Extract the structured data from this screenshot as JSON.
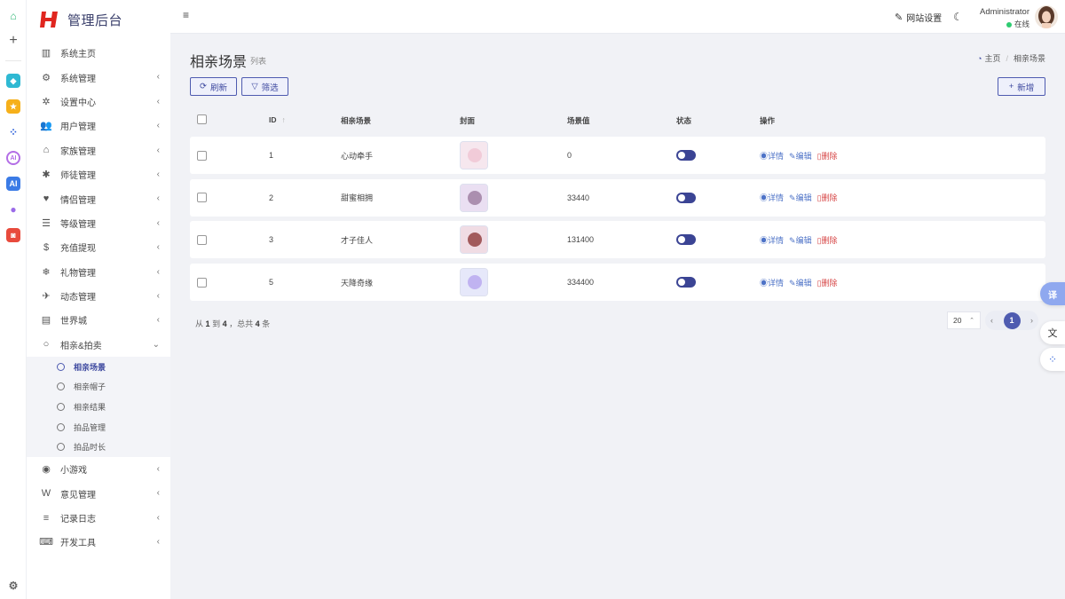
{
  "app": {
    "name": "管理后台"
  },
  "header": {
    "site_settings": "网站设置",
    "user_name": "Administrator",
    "user_status": "在线"
  },
  "sidebar": {
    "items": [
      {
        "label": "系统主页",
        "icon": "chart-icon",
        "arrow": false
      },
      {
        "label": "系统管理",
        "icon": "gear-icon",
        "arrow": true
      },
      {
        "label": "设置中心",
        "icon": "cog-icon",
        "arrow": true
      },
      {
        "label": "用户管理",
        "icon": "users-icon",
        "arrow": true
      },
      {
        "label": "家族管理",
        "icon": "home-icon",
        "arrow": true
      },
      {
        "label": "师徒管理",
        "icon": "asterisk-icon",
        "arrow": true
      },
      {
        "label": "情侣管理",
        "icon": "heart-icon",
        "arrow": true
      },
      {
        "label": "等级管理",
        "icon": "list-icon",
        "arrow": true
      },
      {
        "label": "充值提现",
        "icon": "dollar-icon",
        "arrow": true
      },
      {
        "label": "礼物管理",
        "icon": "snowflake-icon",
        "arrow": true
      },
      {
        "label": "动态管理",
        "icon": "bird-icon",
        "arrow": true
      },
      {
        "label": "世界城",
        "icon": "map-icon",
        "arrow": true
      }
    ],
    "expanded": {
      "label": "相亲&拍卖",
      "icon": "circle-icon"
    },
    "sub_items": [
      {
        "label": "相亲场景",
        "active": true
      },
      {
        "label": "相亲帽子",
        "active": false
      },
      {
        "label": "相亲结果",
        "active": false
      },
      {
        "label": "拍品管理",
        "active": false
      },
      {
        "label": "拍品时长",
        "active": false
      }
    ],
    "items_after": [
      {
        "label": "小游戏",
        "icon": "gamepad-icon"
      },
      {
        "label": "意见管理",
        "icon": "word-icon"
      },
      {
        "label": "记录日志",
        "icon": "table-icon"
      },
      {
        "label": "开发工具",
        "icon": "keyboard-icon"
      }
    ]
  },
  "page": {
    "title": "相亲场景",
    "subtitle": "列表",
    "breadcrumb": {
      "home": "主页",
      "current": "相亲场景"
    },
    "refresh_label": "刷新",
    "filter_label": "筛选",
    "add_label": "新增"
  },
  "table": {
    "columns": [
      "ID",
      "相亲场景",
      "封面",
      "场景值",
      "状态",
      "操作"
    ],
    "rows": [
      {
        "id": "1",
        "name": "心动牵手",
        "value": "0",
        "status_on": false
      },
      {
        "id": "2",
        "name": "甜蜜相拥",
        "value": "33440",
        "status_on": false
      },
      {
        "id": "3",
        "name": "才子佳人",
        "value": "131400",
        "status_on": false
      },
      {
        "id": "5",
        "name": "天降奇缘",
        "value": "334400",
        "status_on": false
      }
    ],
    "actions": {
      "view": "详情",
      "edit": "编辑",
      "delete": "删除"
    }
  },
  "footer": {
    "from_label": "从",
    "from": "1",
    "to_label": "到",
    "to": "4",
    "total_label": "，总共",
    "total": "4",
    "unit": "条",
    "page_size": "20",
    "current_page": "1"
  },
  "float_buttons": {
    "translate": "译"
  }
}
